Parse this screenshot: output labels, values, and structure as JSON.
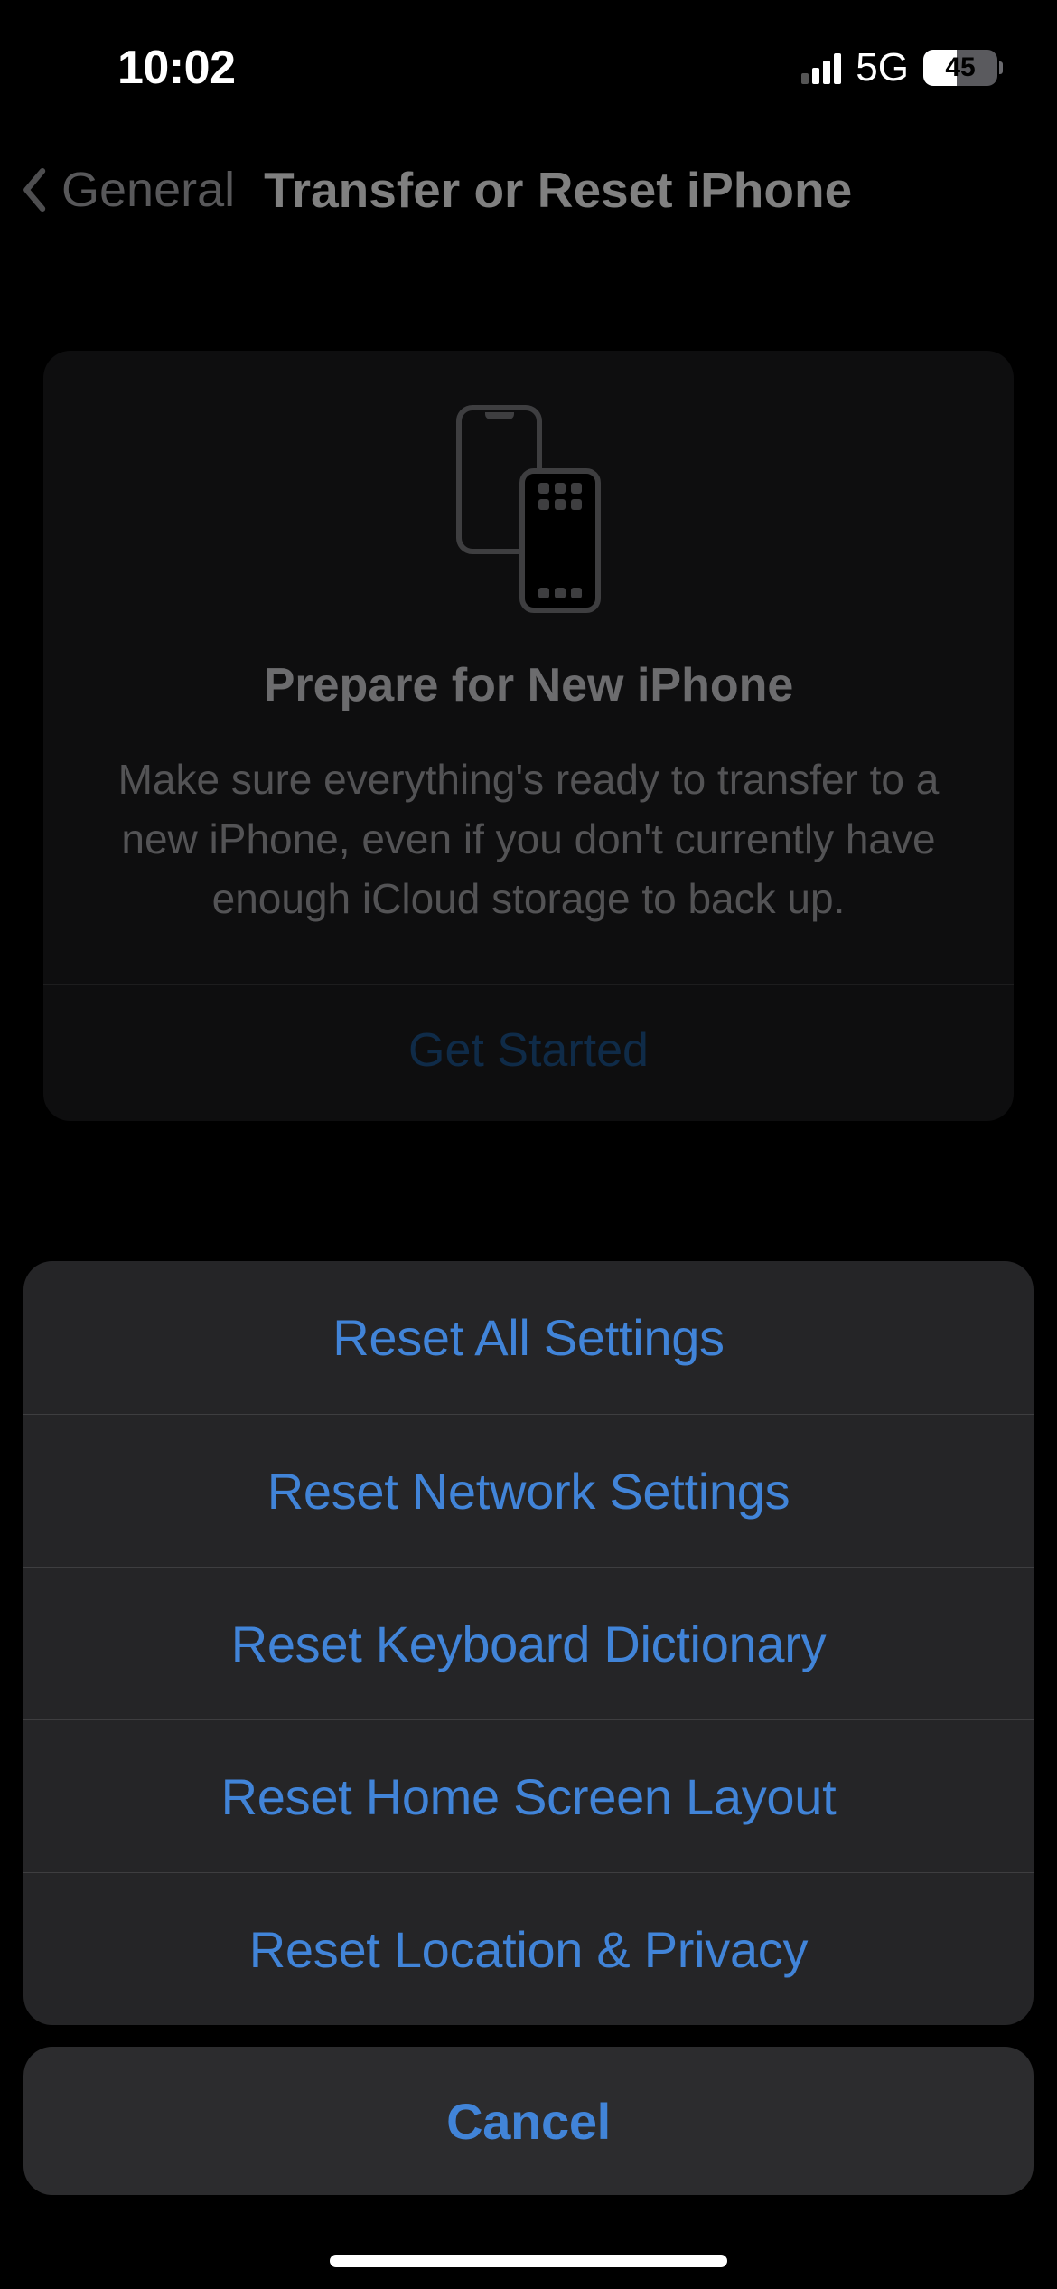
{
  "status": {
    "time": "10:02",
    "network_type": "5G",
    "battery_percent": "45"
  },
  "nav": {
    "back_label": "General",
    "title": "Transfer or Reset iPhone"
  },
  "info_card": {
    "title": "Prepare for New iPhone",
    "description": "Make sure everything's ready to transfer to a new iPhone, even if you don't currently have enough iCloud storage to back up.",
    "cta": "Get Started"
  },
  "action_sheet": {
    "options": [
      "Reset All Settings",
      "Reset Network Settings",
      "Reset Keyboard Dictionary",
      "Reset Home Screen Layout",
      "Reset Location & Privacy"
    ],
    "cancel": "Cancel"
  },
  "colors": {
    "system_blue": "#4184d8",
    "sheet_bg": "#252527",
    "cancel_bg": "#2c2c2e"
  }
}
